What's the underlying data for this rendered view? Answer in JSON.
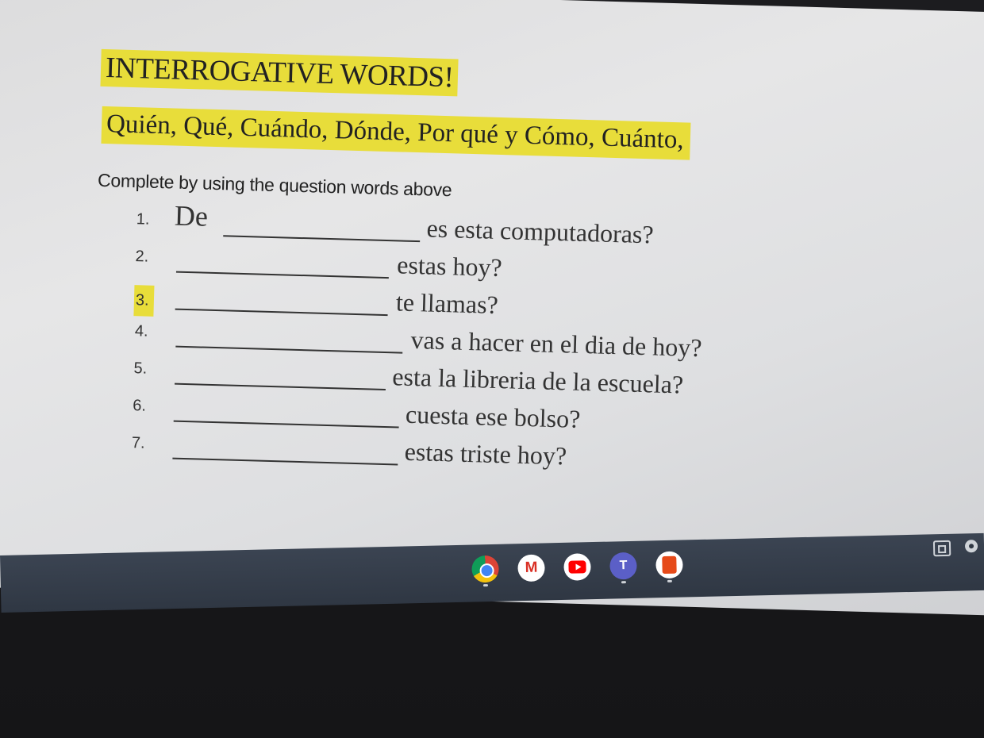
{
  "document": {
    "title": "INTERROGATIVE WORDS!",
    "subtitle": "Quién, Qué, Cuándo, Dónde, Por qué y Cómo,  Cuánto,",
    "instructions": "Complete by using the question words above",
    "questions": [
      {
        "number": "1.",
        "prefix": "De",
        "text": "es esta computadoras?"
      },
      {
        "number": "2.",
        "prefix": "",
        "text": "estas hoy?"
      },
      {
        "number": "3.",
        "prefix": "",
        "text": "te llamas?",
        "number_highlighted": true
      },
      {
        "number": "4.",
        "prefix": "",
        "text": "vas a hacer en el dia de hoy?"
      },
      {
        "number": "5.",
        "prefix": "",
        "text": "esta la libreria de la escuela?"
      },
      {
        "number": "6.",
        "prefix": "",
        "text": "cuesta ese bolso?"
      },
      {
        "number": "7.",
        "prefix": "",
        "text": "estas triste hoy?"
      }
    ],
    "highlight_color": "#e8dd3a"
  },
  "shelf": {
    "apps": [
      {
        "name": "chrome-icon"
      },
      {
        "name": "gmail-icon",
        "glyph": "M"
      },
      {
        "name": "youtube-icon"
      },
      {
        "name": "teams-icon",
        "glyph": "T"
      },
      {
        "name": "office-icon"
      }
    ],
    "tray": [
      "overview-icon",
      "status-icon"
    ]
  }
}
